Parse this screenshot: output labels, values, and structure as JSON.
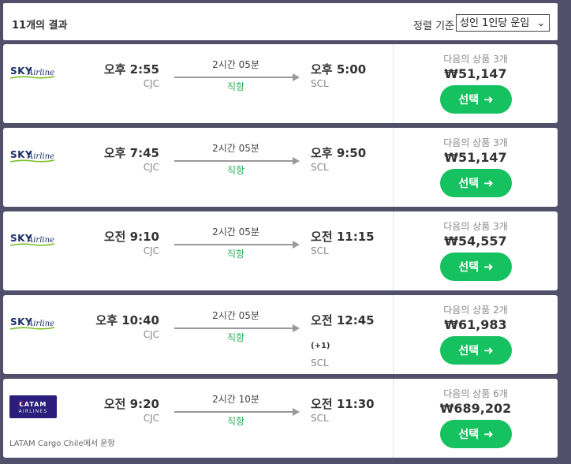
{
  "header": {
    "result_count": "11개의 결과",
    "sort_label": "정렬 기준",
    "sort_value": "성인 1인당 운임"
  },
  "results": [
    {
      "airline": "SKY Airline",
      "logo_type": "sky",
      "dep_time": "오후 2:55",
      "dep_code": "CJC",
      "duration": "2시간 05분",
      "stops": "직항",
      "arr_time": "오후 5:00",
      "arr_code": "SCL",
      "next_day": "",
      "offers": "다음의 상품 3개",
      "price": "₩51,147",
      "select_label": "선택",
      "operated_by": ""
    },
    {
      "airline": "SKY Airline",
      "logo_type": "sky",
      "dep_time": "오후 7:45",
      "dep_code": "CJC",
      "duration": "2시간 05분",
      "stops": "직항",
      "arr_time": "오후 9:50",
      "arr_code": "SCL",
      "next_day": "",
      "offers": "다음의 상품 3개",
      "price": "₩51,147",
      "select_label": "선택",
      "operated_by": ""
    },
    {
      "airline": "SKY Airline",
      "logo_type": "sky",
      "dep_time": "오전 9:10",
      "dep_code": "CJC",
      "duration": "2시간 05분",
      "stops": "직항",
      "arr_time": "오전 11:15",
      "arr_code": "SCL",
      "next_day": "",
      "offers": "다음의 상품 3개",
      "price": "₩54,557",
      "select_label": "선택",
      "operated_by": ""
    },
    {
      "airline": "SKY Airline",
      "logo_type": "sky",
      "dep_time": "오후 10:40",
      "dep_code": "CJC",
      "duration": "2시간 05분",
      "stops": "직항",
      "arr_time": "오전 12:45",
      "arr_code": "SCL",
      "next_day": "(+1)",
      "offers": "다음의 상품 2개",
      "price": "₩61,983",
      "select_label": "선택",
      "operated_by": ""
    },
    {
      "airline": "LATAM Airlines",
      "logo_type": "latam",
      "dep_time": "오전 9:20",
      "dep_code": "CJC",
      "duration": "2시간 10분",
      "stops": "직항",
      "arr_time": "오전 11:30",
      "arr_code": "SCL",
      "next_day": "",
      "offers": "다음의 상품 6개",
      "price": "₩689,202",
      "select_label": "선택",
      "operated_by": "LATAM Cargo Chile에서 운항"
    }
  ],
  "logo_text": {
    "sky": "SKY",
    "airline": "Airline",
    "latam_1": "LATAM",
    "latam_2": "AIRLINES"
  },
  "colors": {
    "background": "#524f6b",
    "accent_green": "#16c15f",
    "stops_green": "#2cb158",
    "latam_purple": "#2b1d7a"
  },
  "icons": {
    "select_arrow": "arrow-right-icon",
    "sort_chevron": "chevron-down-icon",
    "flight_arrow": "flight-arrow-icon"
  }
}
